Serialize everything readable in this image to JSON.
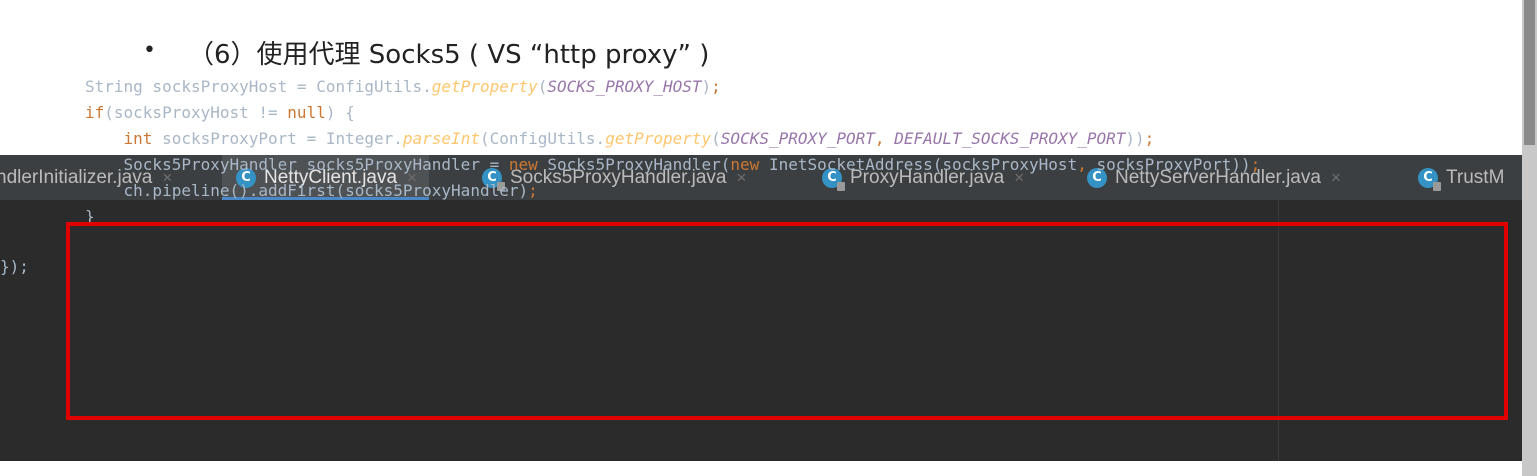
{
  "slide": {
    "bullet": "•",
    "heading": "（6）使用代理 Socks5 ( VS “http proxy” )"
  },
  "tabs": [
    {
      "label": "ndlerInitializer.java",
      "icon": "class-icon",
      "active": false
    },
    {
      "label": "NettyClient.java",
      "icon": "class-icon",
      "active": true
    },
    {
      "label": "Socks5ProxyHandler.java",
      "icon": "library-class-icon",
      "active": false
    },
    {
      "label": "ProxyHandler.java",
      "icon": "library-class-icon",
      "active": false
    },
    {
      "label": "NettyServerHandler.java",
      "icon": "class-icon",
      "active": false
    },
    {
      "label": "TrustM",
      "icon": "library-class-icon",
      "active": false
    }
  ],
  "tab_close": "×",
  "class_icon_letter": "C",
  "code": {
    "edge_fragment": "});"
  },
  "colors": {
    "keyword": "#cc7832",
    "method_italic": "#ffc66d",
    "constant": "#9876aa",
    "default_text": "#a9b7c6",
    "highlight_border": "#e00000",
    "active_tab_underline": "#4a88c7"
  }
}
